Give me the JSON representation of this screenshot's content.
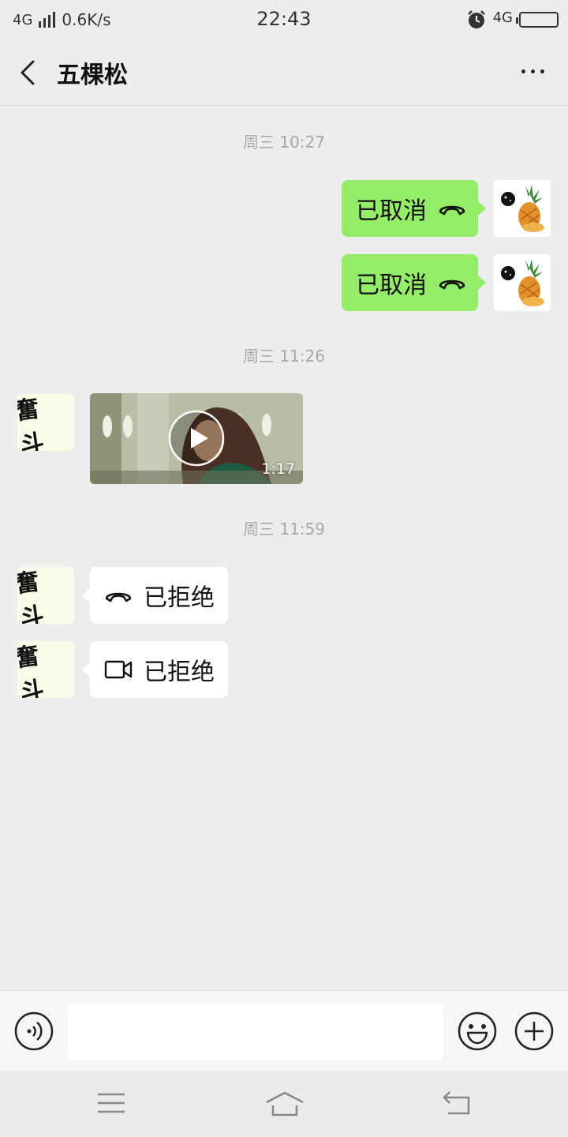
{
  "status_bar": {
    "network_left": "4G",
    "speed": "0.6K/s",
    "time": "22:43",
    "network_right": "4G"
  },
  "header": {
    "title": "五棵松"
  },
  "messages": {
    "ts1": "周三 10:27",
    "m1_text": "已取消",
    "m2_text": "已取消",
    "ts2": "周三 11:26",
    "video_duration": "1:17",
    "ts3": "周三 11:59",
    "m4_text": "已拒绝",
    "m5_text": "已拒绝",
    "other_avatar_text": "奮斗"
  },
  "input": {
    "placeholder": ""
  },
  "colors": {
    "background": "#ededed",
    "self_bubble": "#95ec69",
    "other_bubble": "#ffffff",
    "timestamp": "#a8a8a8"
  },
  "icons": {
    "call": "phone-hangup-icon",
    "video": "video-camera-icon",
    "voice": "voice-icon",
    "emoji": "emoji-icon",
    "plus": "plus-icon"
  }
}
